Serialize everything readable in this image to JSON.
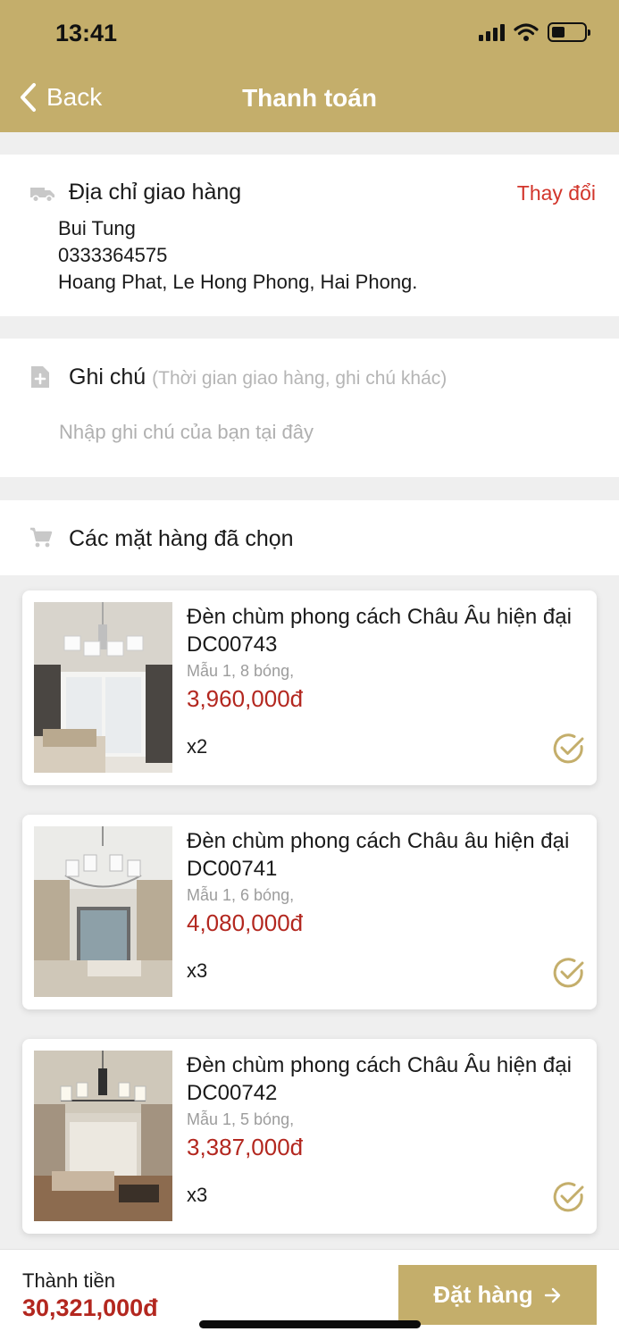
{
  "status_bar": {
    "time": "13:41"
  },
  "nav": {
    "back_label": "Back",
    "title": "Thanh toán"
  },
  "address": {
    "title": "Địa chỉ giao hàng",
    "change_label": "Thay đổi",
    "name": "Bui Tung",
    "phone": "0333364575",
    "address": "Hoang Phat, Le Hong Phong, Hai Phong."
  },
  "note": {
    "title": "Ghi chú",
    "hint": "(Thời gian giao hàng, ghi chú khác)",
    "placeholder": "Nhập ghi chú của bạn tại đây"
  },
  "items_section": {
    "title": "Các mặt hàng đã chọn"
  },
  "items": [
    {
      "name": "Đèn chùm phong cách Châu Âu hiện đại DC00743",
      "variant": "Mẫu 1, 8 bóng,",
      "price": "3,960,000đ",
      "qty": "x2",
      "checked": true
    },
    {
      "name": "Đèn chùm phong cách Châu âu hiện đại DC00741",
      "variant": "Mẫu 1, 6 bóng,",
      "price": "4,080,000đ",
      "qty": "x3",
      "checked": true
    },
    {
      "name": "Đèn chùm phong cách Châu Âu hiện đại DC00742",
      "variant": "Mẫu 1, 5 bóng,",
      "price": "3,387,000đ",
      "qty": "x3",
      "checked": true
    }
  ],
  "footer": {
    "total_label": "Thành tiền",
    "total_value": "30,321,000đ",
    "order_label": "Đặt hàng"
  },
  "colors": {
    "brand": "#c4ae6b",
    "price": "#b3271f",
    "link": "#d2352b"
  },
  "icons": [
    "chevron-left-icon",
    "truck-icon",
    "note-add-icon",
    "cart-icon",
    "check-circle-icon",
    "arrow-right-icon",
    "signal-icon",
    "wifi-icon",
    "battery-icon"
  ]
}
